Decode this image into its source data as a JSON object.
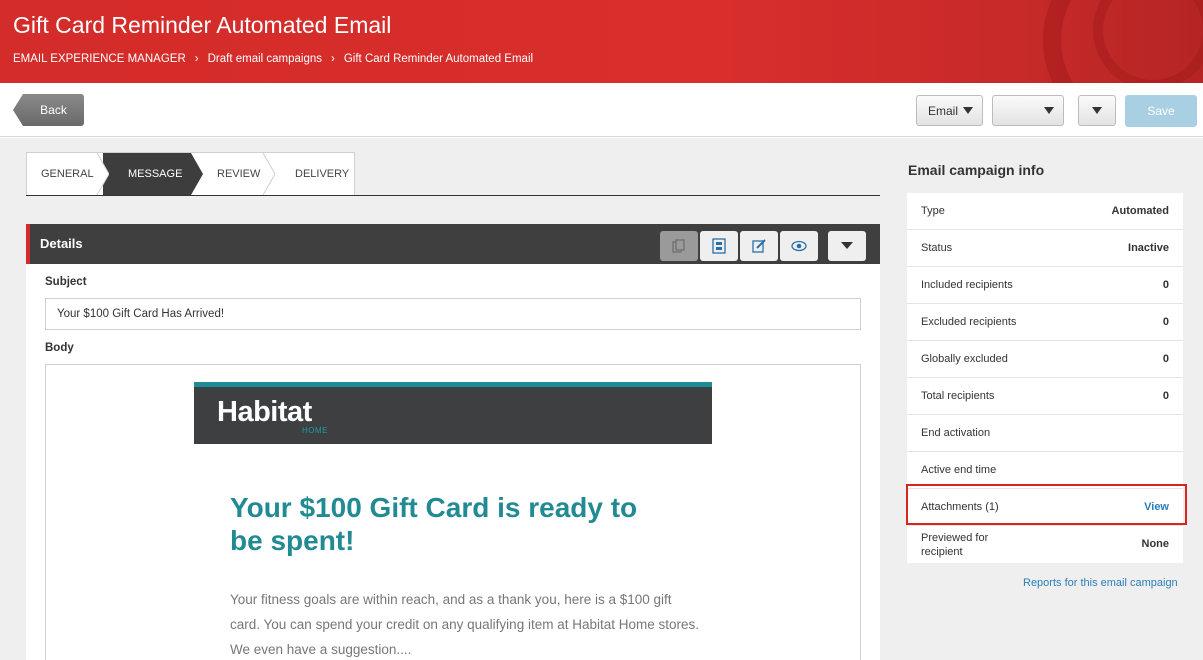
{
  "header": {
    "title": "Gift Card Reminder Automated Email",
    "breadcrumb": [
      "EMAIL EXPERIENCE MANAGER",
      "Draft email campaigns",
      "Gift Card Reminder Automated Email"
    ]
  },
  "toolbar": {
    "back_label": "Back",
    "email_dropdown": "Email",
    "second_dropdown": "",
    "save_label": "Save"
  },
  "steps": [
    {
      "label": "GENERAL",
      "active": false
    },
    {
      "label": "MESSAGE",
      "active": true
    },
    {
      "label": "REVIEW",
      "active": false
    },
    {
      "label": "DELIVERY",
      "active": false
    }
  ],
  "details": {
    "title": "Details",
    "subject_label": "Subject",
    "subject_value": "Your $100 Gift Card Has Arrived!",
    "body_label": "Body",
    "toolbar_icons": [
      "copy-icon",
      "layout-icon",
      "edit-icon",
      "preview-eye-icon",
      "chevron-down-icon"
    ]
  },
  "email": {
    "logo": "Habitat",
    "logo_sub": "HOME",
    "headline": "Your $100 Gift Card is ready to be spent!",
    "body": "Your fitness goals are within reach, and as a thank you, here is a $100 gift card. You can spend your credit on any qualifying item at Habitat Home stores. We even have a suggestion....",
    "accent_color": "#228a92"
  },
  "info": {
    "title": "Email campaign info",
    "rows": [
      {
        "key": "Type",
        "value": "Automated"
      },
      {
        "key": "Status",
        "value": "Inactive"
      },
      {
        "key": "Included recipients",
        "value": "0"
      },
      {
        "key": "Excluded recipients",
        "value": "0"
      },
      {
        "key": "Globally excluded",
        "value": "0"
      },
      {
        "key": "Total recipients",
        "value": "0"
      },
      {
        "key": "End activation",
        "value": ""
      },
      {
        "key": "Active end time",
        "value": ""
      },
      {
        "key": "Attachments (1)",
        "value": "View"
      },
      {
        "key": "Previewed for recipient",
        "value": "None"
      }
    ],
    "reports_link": "Reports for this email campaign"
  },
  "colors": {
    "header_red": "#d42c2a",
    "link_blue": "#2a7fb8",
    "save_disabled": "#a9cfe3",
    "highlight_red": "#d7261f"
  }
}
